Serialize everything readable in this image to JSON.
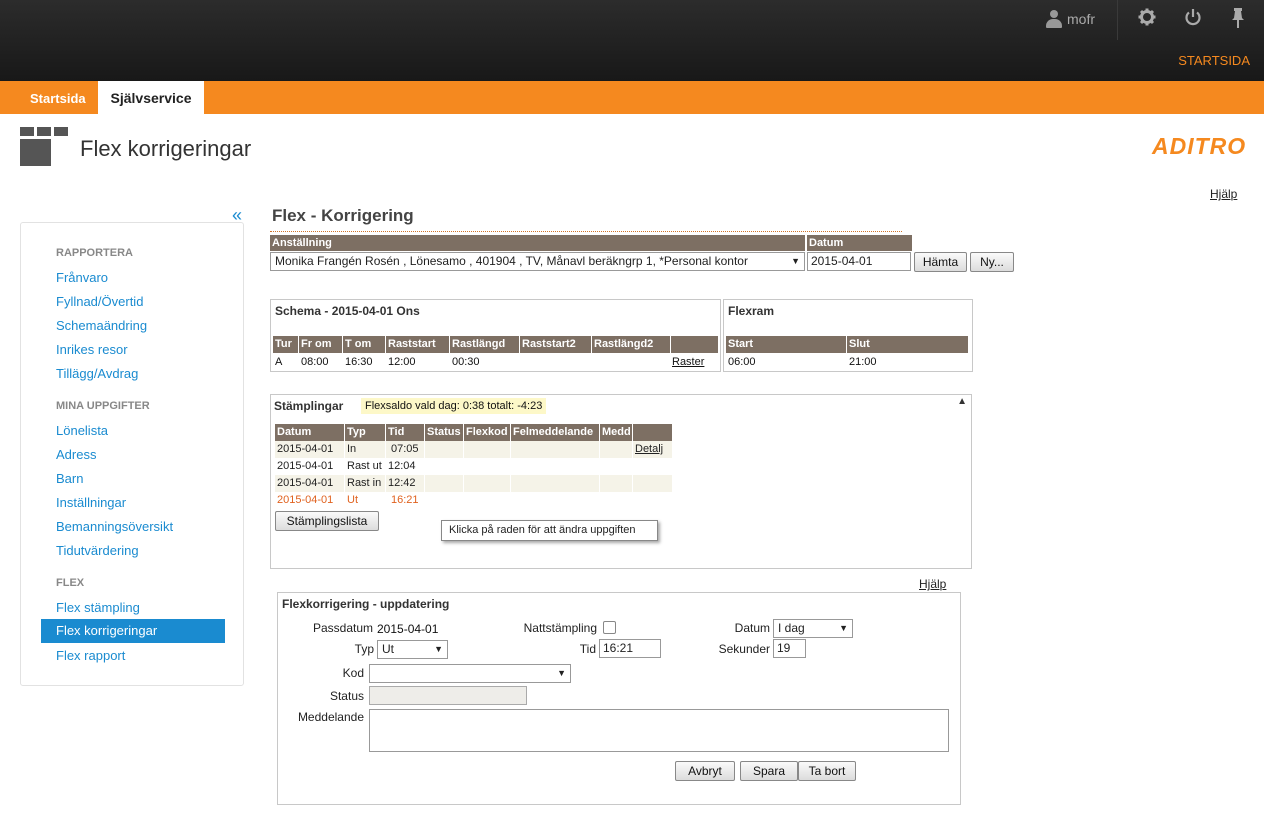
{
  "topbar": {
    "username": "mofr",
    "startsida_link": "STARTSIDA",
    "icons": [
      "user-icon",
      "gear-icon",
      "power-icon",
      "pin-icon"
    ]
  },
  "nav": {
    "tab_startsida": "Startsida",
    "tab_sjalvservice": "Självservice"
  },
  "header": {
    "title": "Flex korrigeringar",
    "brand": "ADITRO"
  },
  "help_label": "Hjälp",
  "sidebar": {
    "collapse": "«",
    "sections": [
      {
        "heading": "RAPPORTERA",
        "items": [
          "Frånvaro",
          "Fyllnad/Övertid",
          "Schemaändring",
          "Inrikes resor",
          "Tillägg/Avdrag"
        ]
      },
      {
        "heading": "MINA UPPGIFTER",
        "items": [
          "Lönelista",
          "Adress",
          "Barn",
          "Inställningar",
          "Bemanningsöversikt",
          "Tidutvärdering"
        ]
      },
      {
        "heading": "FLEX",
        "items": [
          "Flex stämpling",
          "Flex korrigeringar",
          "Flex rapport"
        ]
      }
    ],
    "active_item": "Flex korrigeringar"
  },
  "main": {
    "title": "Flex - Korrigering",
    "anstallning_label": "Anställning",
    "anstallning_value": "Monika Frangén Rosén , Lönesamo , 401904 , TV, Månavl beräkngrp 1, *Personal kontor",
    "datum_label": "Datum",
    "datum_value": "2015-04-01",
    "btn_hamta": "Hämta",
    "btn_ny": "Ny...",
    "schema": {
      "title": "Schema - 2015-04-01 Ons",
      "headers": [
        "Tur",
        "Fr om",
        "T om",
        "Raststart",
        "Rastlängd",
        "Raststart2",
        "Rastlängd2",
        ""
      ],
      "row": [
        "A",
        "08:00",
        "16:30",
        "12:00",
        "00:30",
        "",
        "",
        "Raster"
      ]
    },
    "flexram": {
      "title": "Flexram",
      "headers": [
        "Start",
        "Slut"
      ],
      "row": [
        "06:00",
        "21:00"
      ]
    },
    "stamplingar": {
      "title": "Stämplingar",
      "saldo": "Flexsaldo  vald dag:  0:38  totalt: -4:23",
      "headers": [
        "Datum",
        "Typ",
        "Tid",
        "Status",
        "Flexkod",
        "Felmeddelande",
        "Medd",
        ""
      ],
      "rows": [
        [
          "2015-04-01",
          "In",
          "07:05",
          "",
          "",
          "",
          "",
          "Detalj"
        ],
        [
          "2015-04-01",
          "Rast ut",
          "12:04",
          "",
          "",
          "",
          "",
          ""
        ],
        [
          "2015-04-01",
          "Rast in",
          "12:42",
          "",
          "",
          "",
          "",
          ""
        ],
        [
          "2015-04-01",
          "Ut",
          "16:21",
          "",
          "",
          "",
          "",
          ""
        ]
      ],
      "btn_list": "Stämplingslista",
      "tooltip": "Klicka på raden för att ändra uppgiften"
    },
    "update": {
      "title": "Flexkorrigering - uppdatering",
      "passdatum_label": "Passdatum",
      "passdatum_value": "2015-04-01",
      "natt_label": "Nattstämpling",
      "datum_label": "Datum",
      "datum_select": "I dag",
      "typ_label": "Typ",
      "typ_select": "Ut",
      "tid_label": "Tid",
      "tid_value": "16:21",
      "sekunder_label": "Sekunder",
      "sekunder_value": "19",
      "kod_label": "Kod",
      "kod_select": "",
      "status_label": "Status",
      "status_value": "",
      "meddelande_label": "Meddelande",
      "meddelande_value": "",
      "btn_avbryt": "Avbryt",
      "btn_spara": "Spara",
      "btn_tabort": "Ta bort"
    }
  },
  "colors": {
    "orange": "#f5891f",
    "blue": "#1a8bd0",
    "header_brown": "#7d6f63",
    "highlight_row": "#f5f3e8",
    "flexsaldo_bg": "#fdf8c8",
    "red_row": "#e0621f"
  }
}
